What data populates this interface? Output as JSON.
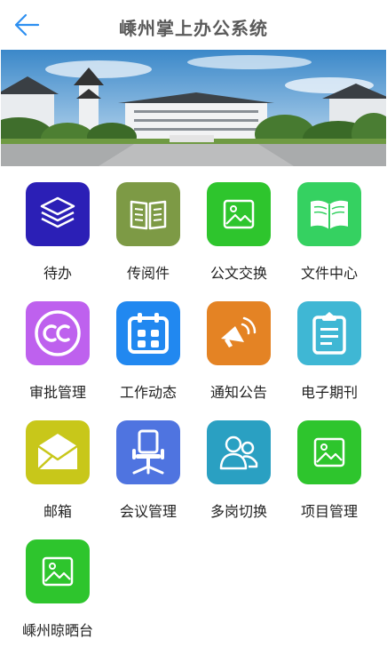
{
  "header": {
    "title": "嵊州掌上办公系统"
  },
  "tiles": [
    {
      "label": "待办",
      "color": "#2b1fb6",
      "icon": "layers-icon"
    },
    {
      "label": "传阅件",
      "color": "#7d9a45",
      "icon": "book-icon"
    },
    {
      "label": "公文交换",
      "color": "#2ec52d",
      "icon": "image-icon"
    },
    {
      "label": "文件中心",
      "color": "#35d161",
      "icon": "open-book-icon"
    },
    {
      "label": "审批管理",
      "color": "#be61ee",
      "icon": "cc-icon"
    },
    {
      "label": "工作动态",
      "color": "#2188f0",
      "icon": "calendar-icon"
    },
    {
      "label": "通知公告",
      "color": "#e48324",
      "icon": "megaphone-icon"
    },
    {
      "label": "电子期刊",
      "color": "#3fb7d4",
      "icon": "clipboard-icon"
    },
    {
      "label": "邮箱",
      "color": "#c8c71a",
      "icon": "envelope-icon"
    },
    {
      "label": "会议管理",
      "color": "#4f74e0",
      "icon": "chair-icon"
    },
    {
      "label": "多岗切换",
      "color": "#2aa0c2",
      "icon": "users-icon"
    },
    {
      "label": "项目管理",
      "color": "#2ec52d",
      "icon": "image-icon"
    },
    {
      "label": "嵊州晾晒台",
      "color": "#2ec52d",
      "icon": "image-icon"
    }
  ]
}
